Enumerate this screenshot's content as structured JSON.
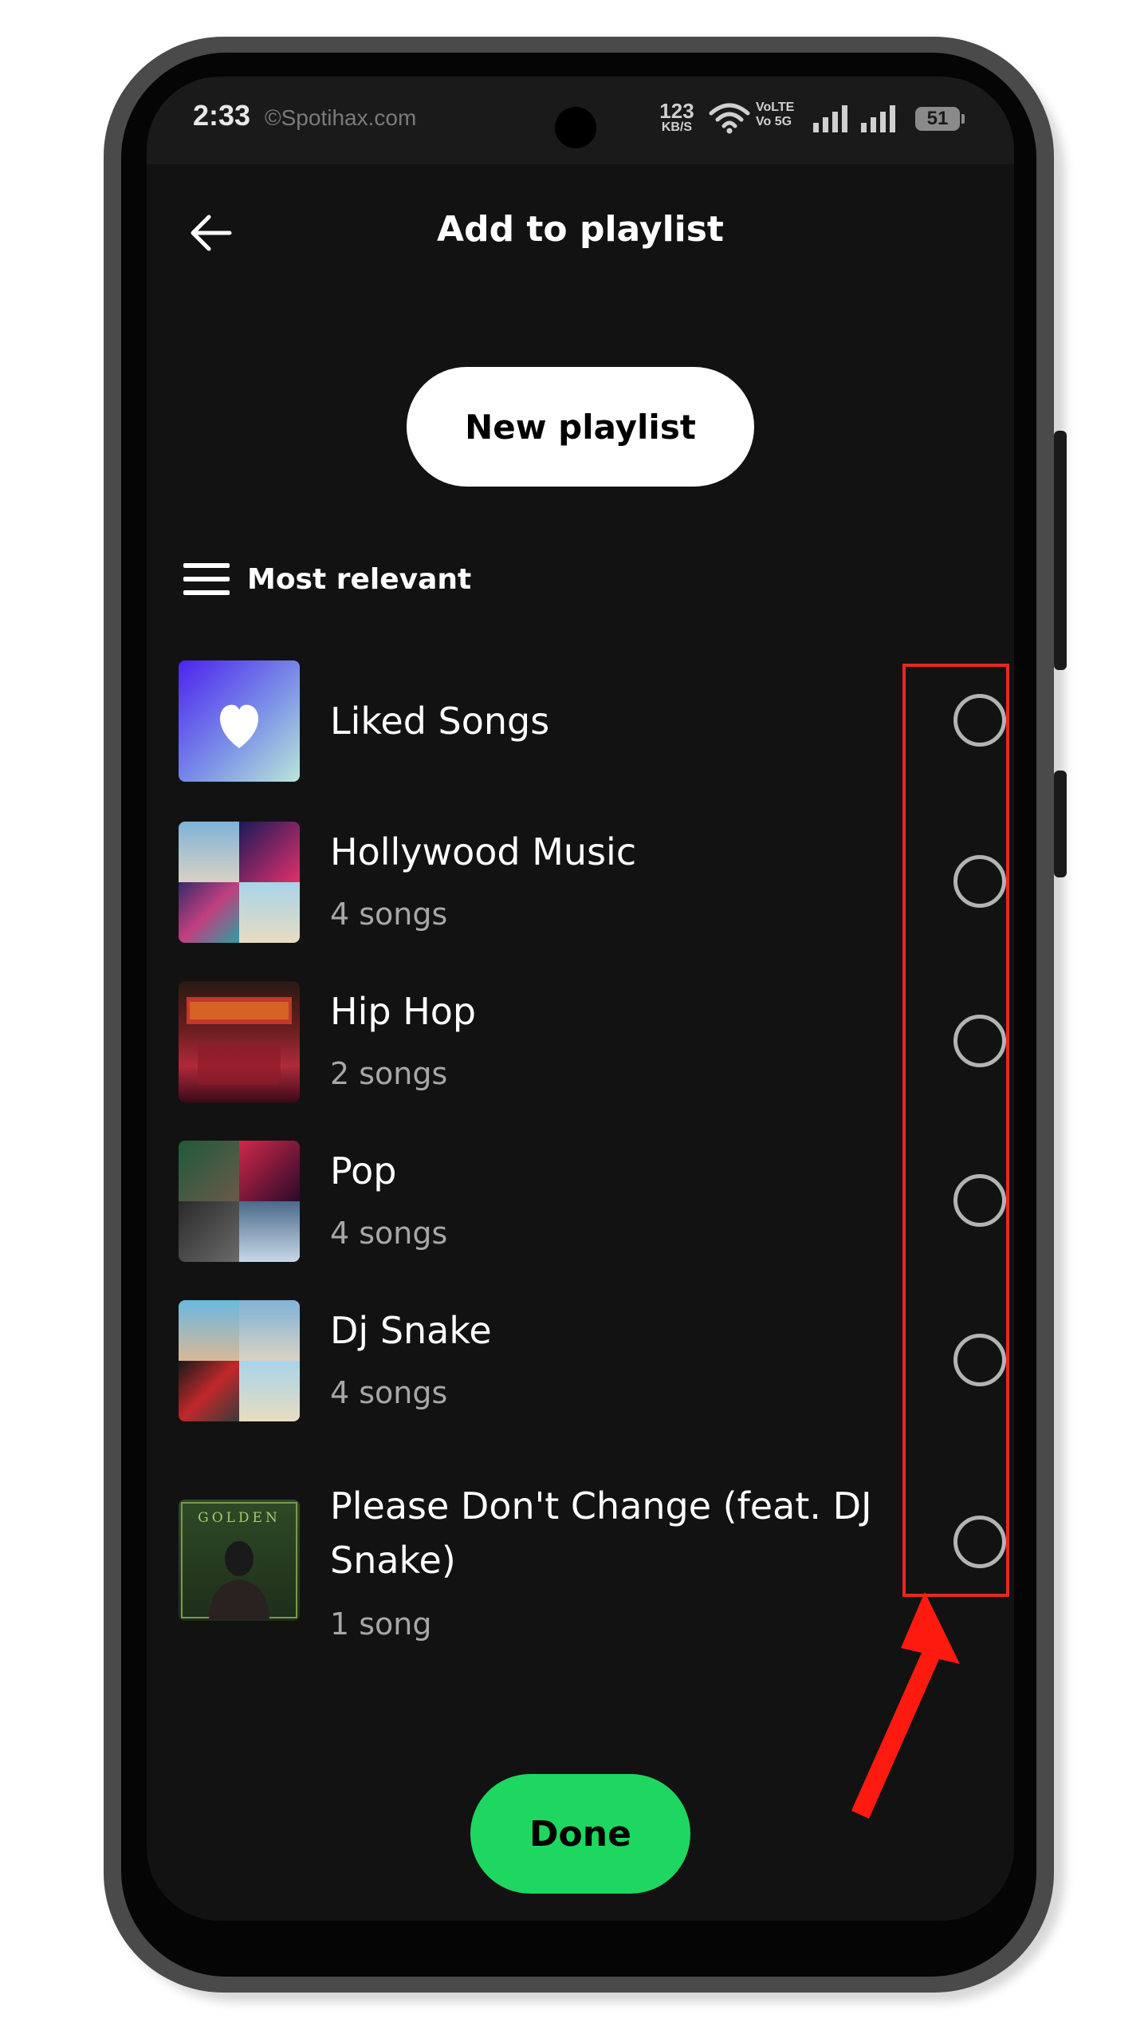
{
  "status_bar": {
    "time": "2:33",
    "watermark": "©Spotihax.com",
    "speed_value": "123",
    "speed_unit": "KB/S",
    "volte_line1": "VoLTE",
    "volte_line2": "Vo 5G",
    "battery": "51"
  },
  "header": {
    "title": "Add to playlist"
  },
  "actions": {
    "new_playlist": "New playlist",
    "done": "Done"
  },
  "sort": {
    "label": "Most relevant"
  },
  "playlists": [
    {
      "title": "Liked Songs",
      "subtitle": "",
      "selected": false
    },
    {
      "title": "Hollywood Music",
      "subtitle": "4 songs",
      "selected": false
    },
    {
      "title": "Hip Hop",
      "subtitle": "2 songs",
      "selected": false
    },
    {
      "title": "Pop",
      "subtitle": "4 songs",
      "selected": false
    },
    {
      "title": "Dj Snake",
      "subtitle": "4 songs",
      "selected": false
    },
    {
      "title": "Please Don't Change (feat. DJ Snake)",
      "subtitle": "1 song",
      "selected": false
    }
  ],
  "colors": {
    "background": "#121212",
    "accent_green": "#1ed760",
    "annotation_red": "#e8281e"
  }
}
